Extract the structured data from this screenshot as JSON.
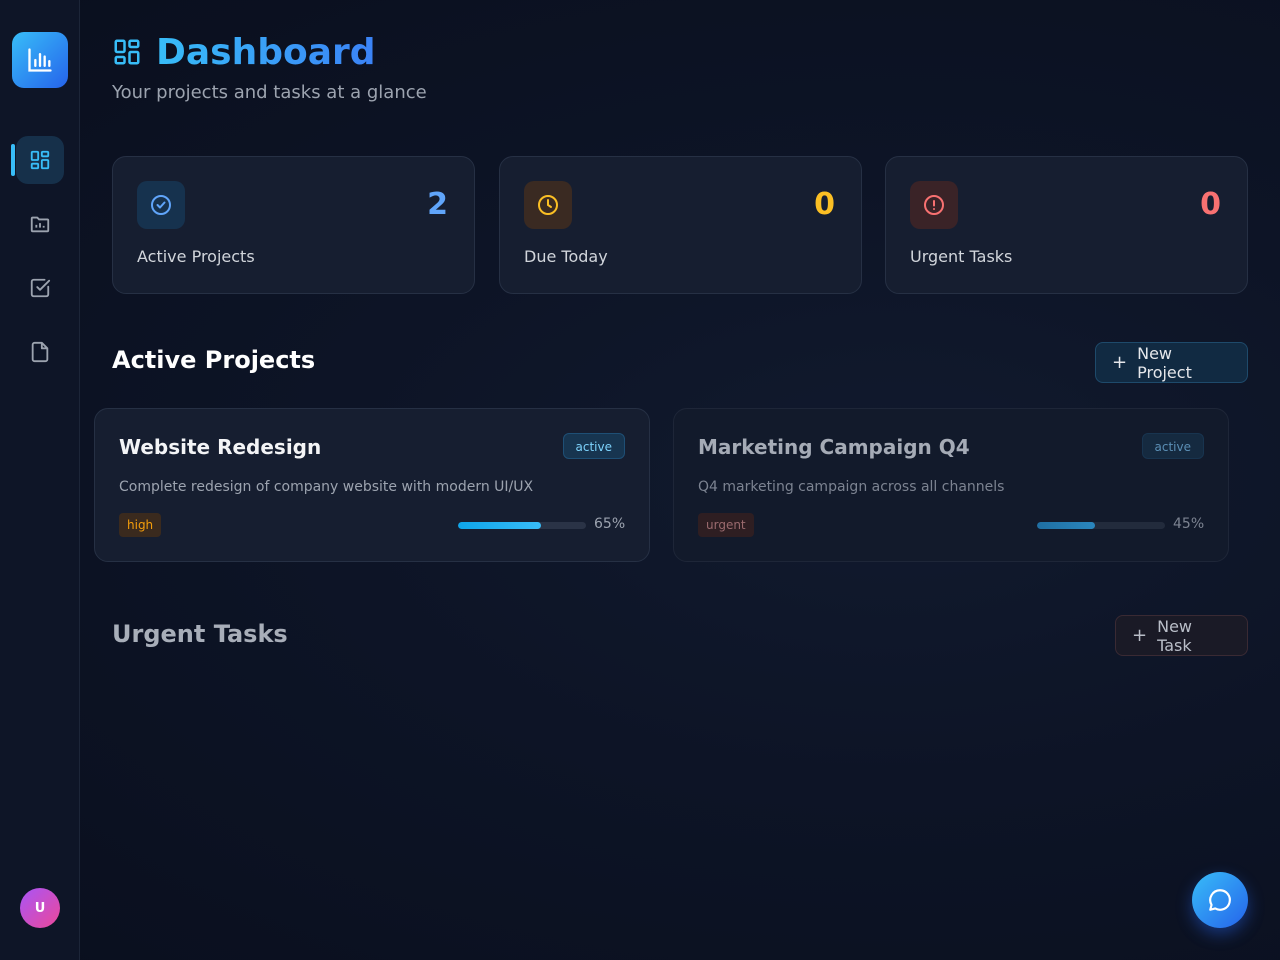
{
  "sidebar": {
    "logo_icon": "bar-chart-icon",
    "items": [
      {
        "name": "dashboard",
        "icon": "grid-icon",
        "active": true
      },
      {
        "name": "projects",
        "icon": "folder-icon",
        "active": false
      },
      {
        "name": "tasks",
        "icon": "checkbox-icon",
        "active": false
      },
      {
        "name": "documents",
        "icon": "file-icon",
        "active": false
      }
    ],
    "avatar_initial": "U"
  },
  "header": {
    "title": "Dashboard",
    "subtitle": "Your projects and tasks at a glance",
    "icon": "grid-icon"
  },
  "stats": [
    {
      "label": "Active Projects",
      "value": "2",
      "icon": "check-circle-icon",
      "color": "#60a5fa"
    },
    {
      "label": "Due Today",
      "value": "0",
      "icon": "clock-icon",
      "color": "#fbbf24"
    },
    {
      "label": "Urgent Tasks",
      "value": "0",
      "icon": "alert-circle-icon",
      "color": "#f87171"
    }
  ],
  "active_projects": {
    "title": "Active Projects",
    "new_button": "New Project",
    "projects": [
      {
        "name": "Website Redesign",
        "status": "active",
        "description": "Complete redesign of company website with modern UI/UX",
        "priority": "high",
        "progress": 65,
        "progress_label": "65%"
      },
      {
        "name": "Marketing Campaign Q4",
        "status": "active",
        "description": "Q4 marketing campaign across all channels",
        "priority": "urgent",
        "progress": 45,
        "progress_label": "45%"
      }
    ]
  },
  "urgent_tasks": {
    "title": "Urgent Tasks",
    "new_button": "New Task"
  },
  "chat": {
    "icon": "chat-bubble-icon"
  },
  "colors": {
    "accent": "#38bdf8",
    "high_priority": "#f59e0b",
    "urgent_priority": "#ef4444"
  }
}
